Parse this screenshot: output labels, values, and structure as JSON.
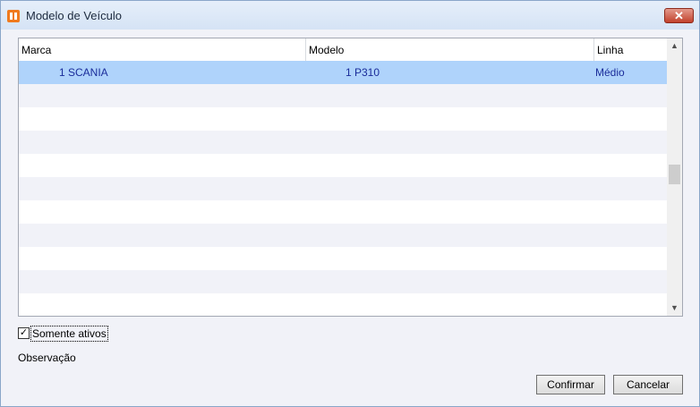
{
  "window": {
    "title": "Modelo de Veículo",
    "close_label": "✕"
  },
  "grid": {
    "columns": [
      "Marca",
      "Modelo",
      "Linha"
    ],
    "rows": [
      {
        "marca": "1 SCANIA",
        "modelo": "1 P310",
        "linha": "Médio",
        "selected": true
      }
    ],
    "empty_row_count": 10
  },
  "scrollbar": {
    "up_icon": "▲",
    "down_icon": "▼"
  },
  "filter": {
    "active_only_label": "Somente ativos",
    "active_only_checked": true
  },
  "observation": {
    "label": "Observação"
  },
  "buttons": {
    "confirm_label": "Confirmar",
    "cancel_label": "Cancelar"
  },
  "colors": {
    "selected_row": "#afd3fb",
    "alt_row": "#f1f2f8",
    "cell_text": "#1a2c9a"
  }
}
